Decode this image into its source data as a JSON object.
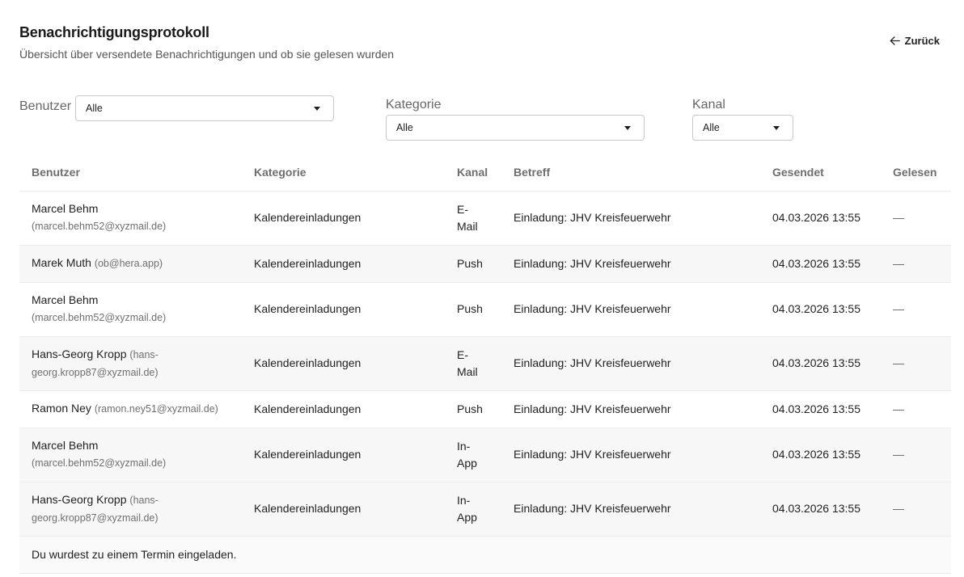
{
  "header": {
    "title": "Benachrichtigungsprotokoll",
    "subtitle": "Übersicht über versendete Benachrichtigungen und ob sie gelesen wurden",
    "back_label": "Zurück"
  },
  "filters": {
    "user": {
      "label": "Benutzer",
      "value": "Alle"
    },
    "category": {
      "label": "Kategorie",
      "value": "Alle"
    },
    "channel": {
      "label": "Kanal",
      "value": "Alle"
    }
  },
  "table": {
    "columns": [
      "Benutzer",
      "Kategorie",
      "Kanal",
      "Betreff",
      "Gesendet",
      "Gelesen"
    ],
    "rows": [
      {
        "name": "Marcel Behm",
        "email": "(marcel.behm52@xyzmail.de)",
        "category": "Kalendereinladungen",
        "channel_l1": "E-",
        "channel_l2": "Mail",
        "subject": "Einladung: JHV Kreisfeuerwehr",
        "sent": "04.03.2026 13:55",
        "read": "—"
      },
      {
        "name": "Marek Muth",
        "email": "(ob@hera.app)",
        "category": "Kalendereinladungen",
        "channel_l1": "Push",
        "channel_l2": "",
        "subject": "Einladung: JHV Kreisfeuerwehr",
        "sent": "04.03.2026 13:55",
        "read": "—"
      },
      {
        "name": "Marcel Behm",
        "email": "(marcel.behm52@xyzmail.de)",
        "category": "Kalendereinladungen",
        "channel_l1": "Push",
        "channel_l2": "",
        "subject": "Einladung: JHV Kreisfeuerwehr",
        "sent": "04.03.2026 13:55",
        "read": "—"
      },
      {
        "name": "Hans-Georg Kropp",
        "email_l1": "(hans-",
        "email_l2": "georg.kropp87@xyzmail.de)",
        "category": "Kalendereinladungen",
        "channel_l1": "E-",
        "channel_l2": "Mail",
        "subject": "Einladung: JHV Kreisfeuerwehr",
        "sent": "04.03.2026 13:55",
        "read": "—"
      },
      {
        "name": "Ramon Ney",
        "email": "(ramon.ney51@xyzmail.de)",
        "category": "Kalendereinladungen",
        "channel_l1": "Push",
        "channel_l2": "",
        "subject": "Einladung: JHV Kreisfeuerwehr",
        "sent": "04.03.2026 13:55",
        "read": "—"
      },
      {
        "name": "Marcel Behm",
        "email": "(marcel.behm52@xyzmail.de)",
        "category": "Kalendereinladungen",
        "channel_l1": "In-",
        "channel_l2": "App",
        "subject": "Einladung: JHV Kreisfeuerwehr",
        "sent": "04.03.2026 13:55",
        "read": "—"
      },
      {
        "name": "Hans-Georg Kropp",
        "email_l1": "(hans-",
        "email_l2": "georg.kropp87@xyzmail.de)",
        "category": "Kalendereinladungen",
        "channel_l1": "In-",
        "channel_l2": "App",
        "subject": "Einladung: JHV Kreisfeuerwehr",
        "sent": "04.03.2026 13:55",
        "read": "—"
      }
    ],
    "message": "Du wurdest zu einem Termin eingeladen."
  }
}
